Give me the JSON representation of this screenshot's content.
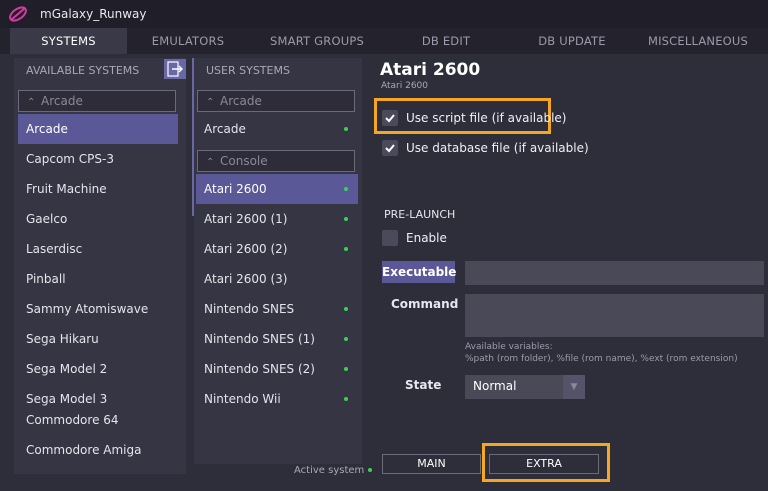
{
  "app": {
    "title": "mGalaxy_Runway",
    "logo_icon": "mgalaxy-logo-icon"
  },
  "tabs": [
    "SYSTEMS",
    "EMULATORS",
    "SMART GROUPS",
    "DB EDIT",
    "DB UPDATE",
    "MISCELLANEOUS"
  ],
  "active_tab": "SYSTEMS",
  "available": {
    "header": "AVAILABLE SYSTEMS",
    "group": "Arcade",
    "items": [
      "Arcade",
      "Capcom CPS-3",
      "Fruit Machine",
      "Gaelco",
      "Laserdisc",
      "Pinball",
      "Sammy Atomiswave",
      "Sega Hikaru",
      "Sega Model 2",
      "Sega Model 3",
      "Commodore 64",
      "Commodore Amiga"
    ],
    "selected": "Arcade"
  },
  "user": {
    "header": "USER SYSTEMS",
    "groups": [
      {
        "name": "Arcade",
        "items": [
          {
            "label": "Arcade",
            "active": true
          }
        ]
      },
      {
        "name": "Console",
        "items": [
          {
            "label": "Atari 2600",
            "active": true
          },
          {
            "label": "Atari 2600 (1)",
            "active": true
          },
          {
            "label": "Atari 2600 (2)",
            "active": true
          },
          {
            "label": "Atari 2600 (3)",
            "active": false
          },
          {
            "label": "Nintendo SNES",
            "active": true
          },
          {
            "label": "Nintendo SNES (1)",
            "active": true
          },
          {
            "label": "Nintendo SNES (2)",
            "active": true
          },
          {
            "label": "Nintendo Wii",
            "active": true
          }
        ]
      }
    ],
    "selected": "Atari 2600",
    "legend": "Active system"
  },
  "detail": {
    "title": "Atari 2600",
    "subtitle": "Atari 2600",
    "use_script": {
      "label": "Use script file (if available)",
      "checked": true
    },
    "use_database": {
      "label": "Use database file (if available)",
      "checked": true
    },
    "pre_launch_label": "PRE-LAUNCH",
    "enable": {
      "label": "Enable",
      "checked": false
    },
    "executable_button": "Executable",
    "executable_value": "",
    "command_label": "Command",
    "command_value": "",
    "vars_header": "Available variables:",
    "vars_text": "%path (rom folder), %file (rom name), %ext (rom extension)",
    "state_label": "State",
    "state_value": "Normal",
    "main_button": "MAIN",
    "extra_button": "EXTRA"
  },
  "colors": {
    "accent": "#5a5896",
    "highlight": "#f5a623",
    "active_dot": "#39d353",
    "background": "#2e2d3a"
  }
}
